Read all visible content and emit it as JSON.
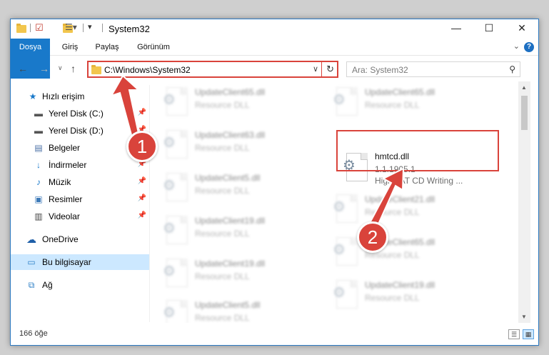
{
  "window": {
    "title": "System32",
    "minimize": "—",
    "maximize": "☐",
    "close": "✕"
  },
  "ribbon": {
    "tabs": [
      "Dosya",
      "Giriş",
      "Paylaş",
      "Görünüm"
    ],
    "collapse": "⌄",
    "help": "?"
  },
  "address": {
    "path": "C:\\Windows\\System32",
    "search_placeholder": "Ara: System32"
  },
  "sidebar": {
    "items": [
      {
        "label": "Hızlı erişim",
        "icon": "star-icon"
      },
      {
        "label": "Yerel Disk (C:)",
        "icon": "drive-icon",
        "pinned": true
      },
      {
        "label": "Yerel Disk (D:)",
        "icon": "drive-icon",
        "pinned": true
      },
      {
        "label": "Belgeler",
        "icon": "document-icon",
        "pinned": true
      },
      {
        "label": "İndirmeler",
        "icon": "download-icon",
        "pinned": true
      },
      {
        "label": "Müzik",
        "icon": "music-icon",
        "pinned": true
      },
      {
        "label": "Resimler",
        "icon": "pictures-icon",
        "pinned": true
      },
      {
        "label": "Videolar",
        "icon": "video-icon",
        "pinned": true
      },
      {
        "label": "OneDrive",
        "icon": "cloud-icon"
      },
      {
        "label": "Bu bilgisayar",
        "icon": "computer-icon",
        "selected": true
      },
      {
        "label": "Ağ",
        "icon": "network-icon"
      }
    ]
  },
  "files": {
    "left": [
      {
        "name": "UpdateClient65.dll",
        "type": "Resource DLL"
      },
      {
        "name": "UpdateClient63.dll",
        "type": "Resource DLL"
      },
      {
        "name": "UpdateClient5.dll",
        "type": "Resource DLL"
      },
      {
        "name": "UpdateClient19.dll",
        "type": "Resource DLL"
      },
      {
        "name": "UpdateClient19.dll",
        "type": "Resource DLL"
      },
      {
        "name": "UpdateClient5.dll",
        "type": "Resource DLL"
      }
    ],
    "right": [
      {
        "name": "UpdateClient65.dll",
        "type": "Resource DLL"
      },
      {
        "name": "UpdateClient21.dll",
        "type": "Resource DLL"
      },
      {
        "name": "UpdateClient65.dll",
        "type": "Resource DLL"
      },
      {
        "name": "UpdateClient19.dll",
        "type": "Resource DLL"
      }
    ],
    "highlighted": {
      "name": "hmtcd.dll",
      "version": "1.1.1905.1",
      "description": "HighMAT CD Writing ..."
    }
  },
  "status": {
    "count": "166 öğe"
  },
  "annotations": {
    "step1": "1",
    "step2": "2"
  },
  "colors": {
    "accent": "#1979ca",
    "highlight": "#d9433b",
    "selected": "#cce8ff"
  }
}
